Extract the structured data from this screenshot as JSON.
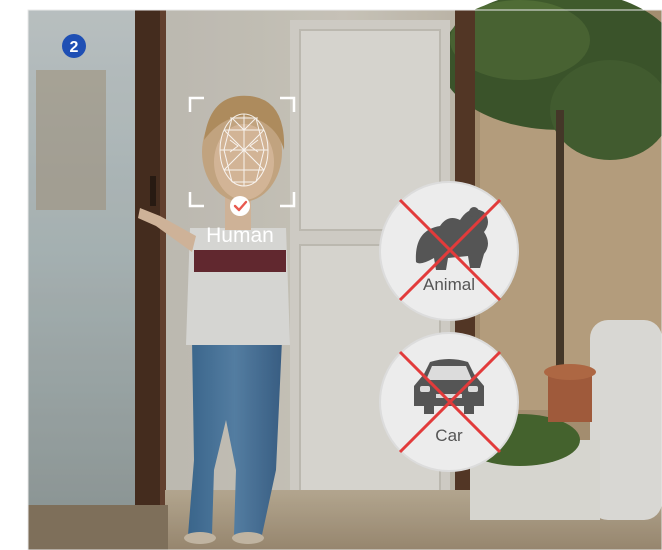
{
  "step_badge": {
    "number": "2",
    "color": "#1f4fb4"
  },
  "detections": {
    "human": {
      "label": "Human",
      "status": "detected",
      "check_color": "#e8594f"
    },
    "animal": {
      "label": "Animal",
      "status": "ignored",
      "cross_color": "#e23b3b"
    },
    "car": {
      "label": "Car",
      "status": "ignored",
      "cross_color": "#e23b3b"
    }
  }
}
